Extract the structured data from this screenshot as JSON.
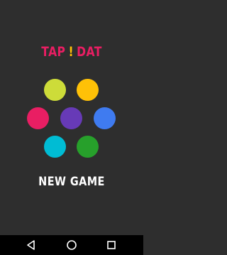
{
  "title": {
    "word1": "TAP",
    "exclaim": "!",
    "word2": "DAT"
  },
  "colors": {
    "background": "#2e2e2e",
    "title": "#e91e63",
    "exclaim": "#ffc107",
    "dot_lime": "#cddc39",
    "dot_amber": "#ffc107",
    "dot_pink": "#e91e63",
    "dot_purple": "#673ab7",
    "dot_blue": "#3f7bf0",
    "dot_cyan": "#00bcd4",
    "dot_green": "#27a02b"
  },
  "menu": {
    "new_game_label": "NEW GAME"
  },
  "navbar": {
    "back_icon": "back-triangle-icon",
    "home_icon": "home-circle-icon",
    "recents_icon": "recents-square-icon"
  }
}
